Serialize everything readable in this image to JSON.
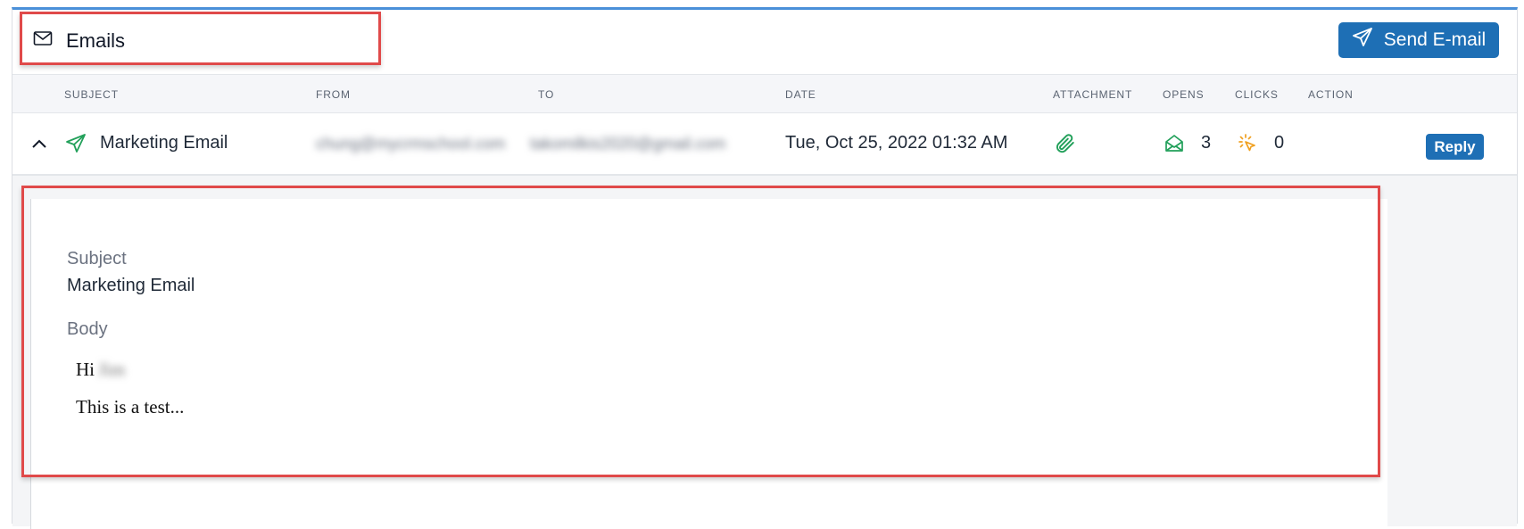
{
  "header": {
    "title": "Emails",
    "title_icon": "envelope-icon",
    "send_button_label": "Send E-mail",
    "send_icon": "paper-plane-icon"
  },
  "table": {
    "columns": [
      "SUBJECT",
      "FROM",
      "TO",
      "DATE",
      "ATTACHMENT",
      "OPENS",
      "CLICKS",
      "ACTION"
    ],
    "rows": [
      {
        "subject": "Marketing Email",
        "from": "chung@mycrmschool.com",
        "to": "takomilkis2020@gmail.com",
        "date": "Tue, Oct 25, 2022 01:32 AM",
        "opens": "3",
        "clicks": "0",
        "action_label": "Reply"
      }
    ]
  },
  "detail": {
    "subject_label": "Subject",
    "subject_value": "Marketing Email",
    "body_label": "Body",
    "body_greeting": "Hi",
    "body_name": "Jim",
    "body_line": "This is a test..."
  },
  "colors": {
    "accent": "#1e6fb5",
    "highlight": "#e04a4a",
    "green": "#22a05a",
    "orange": "#f0a020"
  }
}
